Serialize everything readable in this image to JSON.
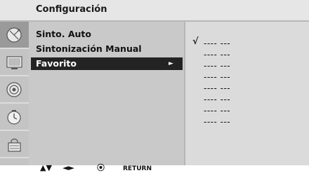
{
  "title": "Configuración",
  "sidebar_icons": [
    {
      "name": "satellite-dish-icon",
      "active": true
    },
    {
      "name": "monitor-icon",
      "active": false
    },
    {
      "name": "speaker-icon",
      "active": false
    },
    {
      "name": "clock-icon",
      "active": false
    },
    {
      "name": "lock-icon",
      "active": false
    }
  ],
  "menu": {
    "items": [
      {
        "label": "Sinto. Auto",
        "selected": false
      },
      {
        "label": "Sintonización Manual",
        "selected": false
      },
      {
        "label": "Favorito",
        "selected": true,
        "arrow": "►"
      }
    ]
  },
  "favorites": {
    "check": "√",
    "entries": [
      "---- ---",
      "---- ---",
      "---- ---",
      "---- ---",
      "---- ---",
      "---- ---",
      "---- ---",
      "---- ---"
    ]
  },
  "footer": {
    "updown": "▲▼",
    "leftright": "◄►",
    "ok_symbol": "⦿",
    "return_label": "RETURN"
  },
  "colors": {
    "selected_bg": "#232323",
    "menu_bg": "#c9c9c9",
    "submenu_bg": "#dbdbdb",
    "title_bg": "#e6e6e6"
  }
}
